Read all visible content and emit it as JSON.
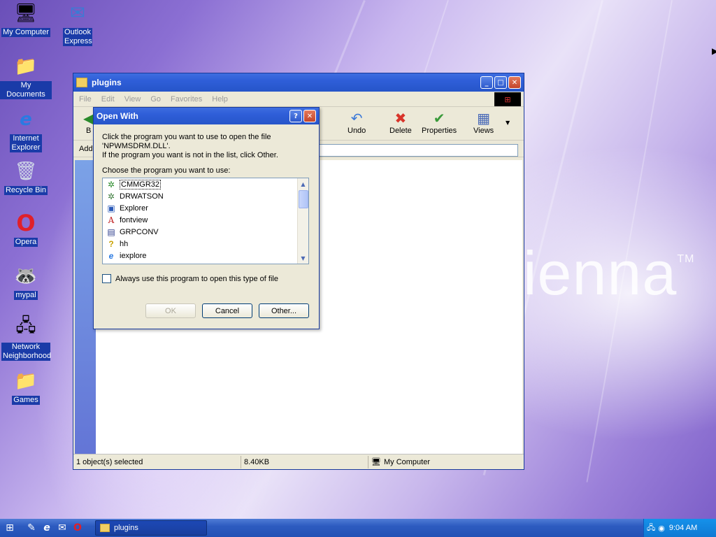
{
  "desktop": {
    "icons": [
      {
        "label": "My Computer",
        "icon": "computer-icon"
      },
      {
        "label": "Outlook Express",
        "icon": "outlook-express-icon"
      },
      {
        "label": "My Documents",
        "icon": "folder-icon"
      },
      {
        "label": "Internet Explorer",
        "icon": "internet-explorer-icon"
      },
      {
        "label": "Recycle Bin",
        "icon": "recycle-bin-icon"
      },
      {
        "label": "Opera",
        "icon": "opera-icon"
      },
      {
        "label": "mypal",
        "icon": "mypal-icon"
      },
      {
        "label": "Network Neighborhood",
        "icon": "network-icon"
      },
      {
        "label": "Games",
        "icon": "folder-icon"
      }
    ],
    "wallpaper_text": "ienna",
    "wallpaper_tm": "TM"
  },
  "explorer": {
    "title": "plugins",
    "menu": [
      "File",
      "Edit",
      "View",
      "Go",
      "Favorites",
      "Help"
    ],
    "toolbar": {
      "back": "B",
      "undo": "Undo",
      "delete": "Delete",
      "properties": "Properties",
      "views": "Views"
    },
    "address_label": "Add",
    "status": {
      "selected": "1 object(s) selected",
      "size": "8.40KB",
      "location": "My Computer"
    }
  },
  "dialog": {
    "title": "Open With",
    "line1": "Click the program you want to use to open the file",
    "line2": "'NPWMSDRM.DLL'.",
    "line3": "If the program you want is not in the list, click Other.",
    "choose_label": "Choose the program you want to use:",
    "programs": [
      {
        "name": "CMMGR32",
        "icon": "cmmgr-icon",
        "glyph": "✲"
      },
      {
        "name": "DRWATSON",
        "icon": "drwatson-icon",
        "glyph": "✲"
      },
      {
        "name": "Explorer",
        "icon": "explorer-icon",
        "glyph": "▣"
      },
      {
        "name": "fontview",
        "icon": "font-icon",
        "glyph": "A"
      },
      {
        "name": "GRPCONV",
        "icon": "grpconv-icon",
        "glyph": "▤"
      },
      {
        "name": "hh",
        "icon": "help-icon",
        "glyph": "?"
      },
      {
        "name": "iexplore",
        "icon": "internet-explorer-icon",
        "glyph": "e"
      }
    ],
    "checkbox_label": "Always use this program to open this type of file",
    "ok": "OK",
    "cancel": "Cancel",
    "other": "Other..."
  },
  "taskbar": {
    "task_label": "plugins",
    "clock": "9:04 AM"
  }
}
